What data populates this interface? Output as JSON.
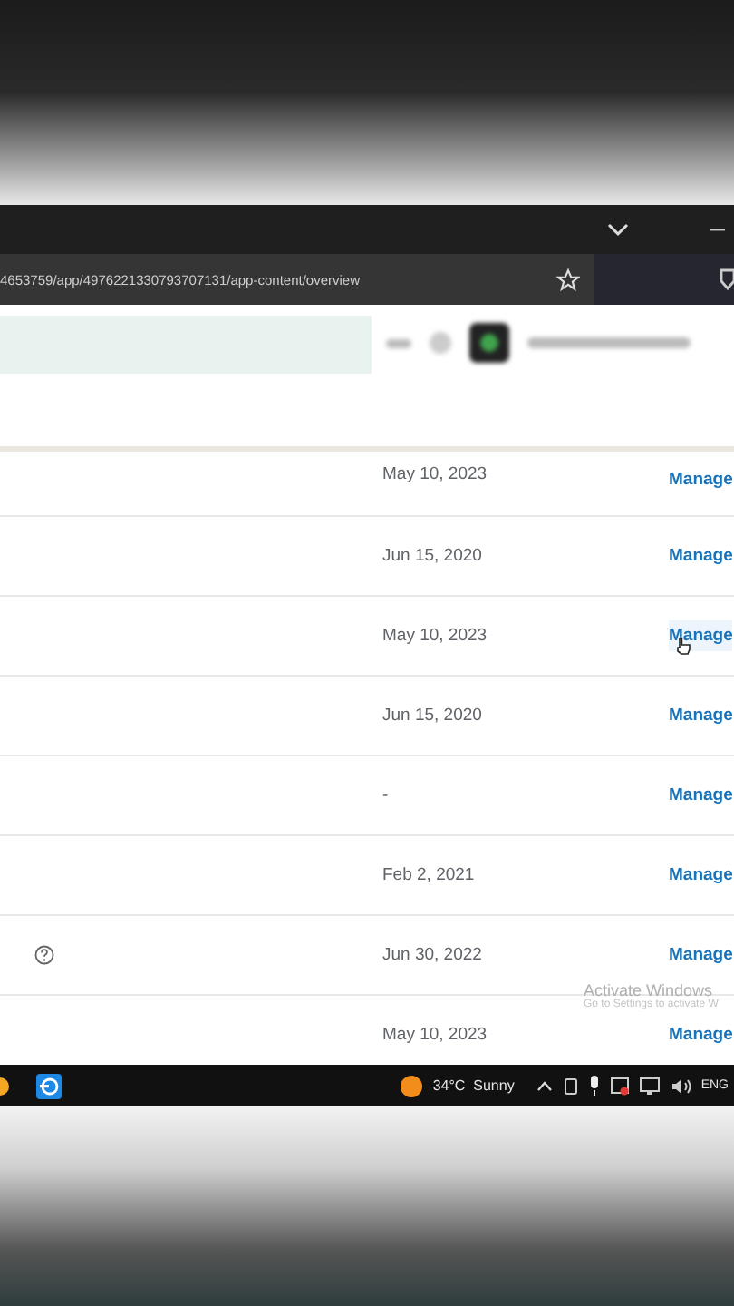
{
  "browser": {
    "url": "4653759/app/4976221330793707131/app-content/overview"
  },
  "rows": [
    {
      "date": "May 10, 2023",
      "help_icon": false,
      "hovered": false,
      "action": "Manage"
    },
    {
      "date": "Jun 15, 2020",
      "help_icon": false,
      "hovered": false,
      "action": "Manage"
    },
    {
      "date": "May 10, 2023",
      "help_icon": false,
      "hovered": true,
      "action": "Manage"
    },
    {
      "date": "Jun 15, 2020",
      "help_icon": false,
      "hovered": false,
      "action": "Manage"
    },
    {
      "date": "-",
      "help_icon": false,
      "hovered": false,
      "action": "Manage"
    },
    {
      "date": "Feb 2, 2021",
      "help_icon": false,
      "hovered": false,
      "action": "Manage"
    },
    {
      "date": "Jun 30, 2022",
      "help_icon": true,
      "hovered": false,
      "action": "Manage"
    },
    {
      "date": "May 10, 2023",
      "help_icon": false,
      "hovered": false,
      "action": "Manage"
    }
  ],
  "watermark": {
    "title": "Activate Windows",
    "subtitle": "Go to Settings to activate W"
  },
  "taskbar": {
    "weather": "34°C  Sunny",
    "language": "ENG"
  }
}
